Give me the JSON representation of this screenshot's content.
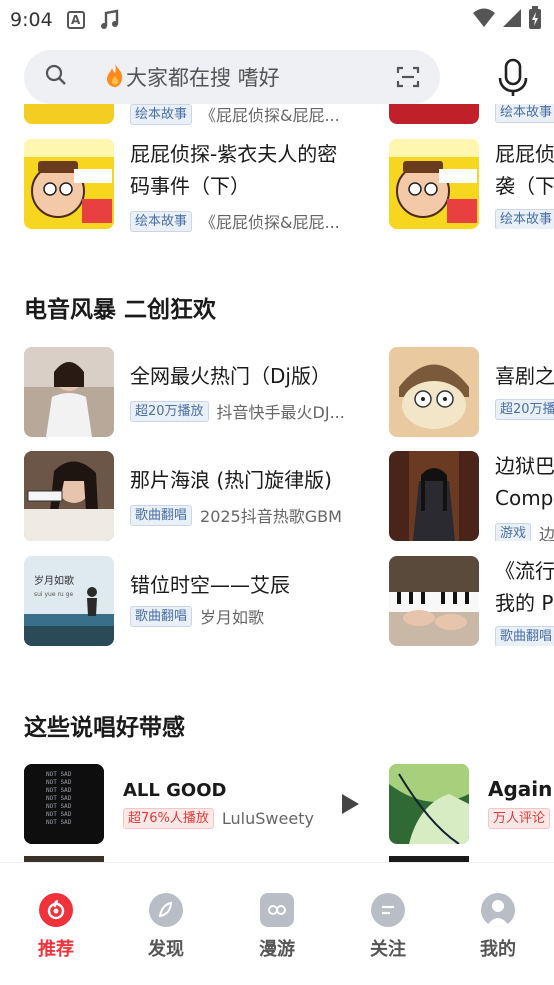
{
  "status_bar": {
    "time": "9:04",
    "icons": [
      "a-notification-icon",
      "music-note-icon",
      "wifi-icon",
      "signal-icon",
      "battery-icon"
    ]
  },
  "search": {
    "hot_icon": "fire-icon",
    "placeholder": "大家都在搜 嗜好"
  },
  "top_partial": {
    "left_tag": "绘本故事",
    "left_sub": "《屁屁侦探&屁屁...",
    "right_tag": "绘本故事"
  },
  "picture_book": [
    {
      "title_line1": "屁屁侦探-紫衣夫人的密",
      "title_line2": "码事件（下）",
      "tag": "绘本故事",
      "sub": "《屁屁侦探&屁屁..."
    },
    {
      "title_line1": "屁屁侦",
      "title_line2": "袭（下",
      "tag": "绘本故事",
      "sub": ""
    }
  ],
  "sections": {
    "electro": "电音风暴 二创狂欢",
    "rap": "这些说唱好带感"
  },
  "electro_left": [
    {
      "title": "全网最火热门（Dj版）",
      "tag": "超20万播放",
      "sub": "抖音快手最火DJ..."
    },
    {
      "title": "那片海浪 (热门旋律版)",
      "tag": "歌曲翻唱",
      "sub": "2025抖音热歌GBM"
    },
    {
      "title": "错位时空——艾辰",
      "tag": "歌曲翻唱",
      "sub": "岁月如歌"
    }
  ],
  "electro_right": [
    {
      "title": "喜剧之",
      "tag": "超20万播",
      "sub": ""
    },
    {
      "title_line1": "边狱巴",
      "title_line2": "Compa",
      "tag": "游戏",
      "sub": "边"
    },
    {
      "title_line1": "《流行",
      "title_line2": "我的 P",
      "tag": "歌曲翻唱",
      "sub": ""
    }
  ],
  "thumb_text": {
    "suiyue": "岁月如歌",
    "suiyue_pinyin": "sui yue ru ge",
    "notsad": "NOT SAD"
  },
  "rap": [
    {
      "title": "ALL GOOD",
      "tag": "超76%人播放",
      "sub": "LuluSweety"
    },
    {
      "title": "Again",
      "tag": "万人评论",
      "sub": ""
    }
  ],
  "bottom_nav": [
    {
      "label": "推荐",
      "icon": "netease-logo-icon",
      "active": true
    },
    {
      "label": "发现",
      "icon": "compass-icon",
      "active": false
    },
    {
      "label": "漫游",
      "icon": "radio-icon",
      "active": false
    },
    {
      "label": "关注",
      "icon": "chat-bubble-icon",
      "active": false
    },
    {
      "label": "我的",
      "icon": "user-icon",
      "active": false
    }
  ],
  "colors": {
    "accent": "#f0333b",
    "tag_blue": "#4a6fa5",
    "tag_red": "#e03a3a",
    "search_bg": "#eef0f4"
  }
}
